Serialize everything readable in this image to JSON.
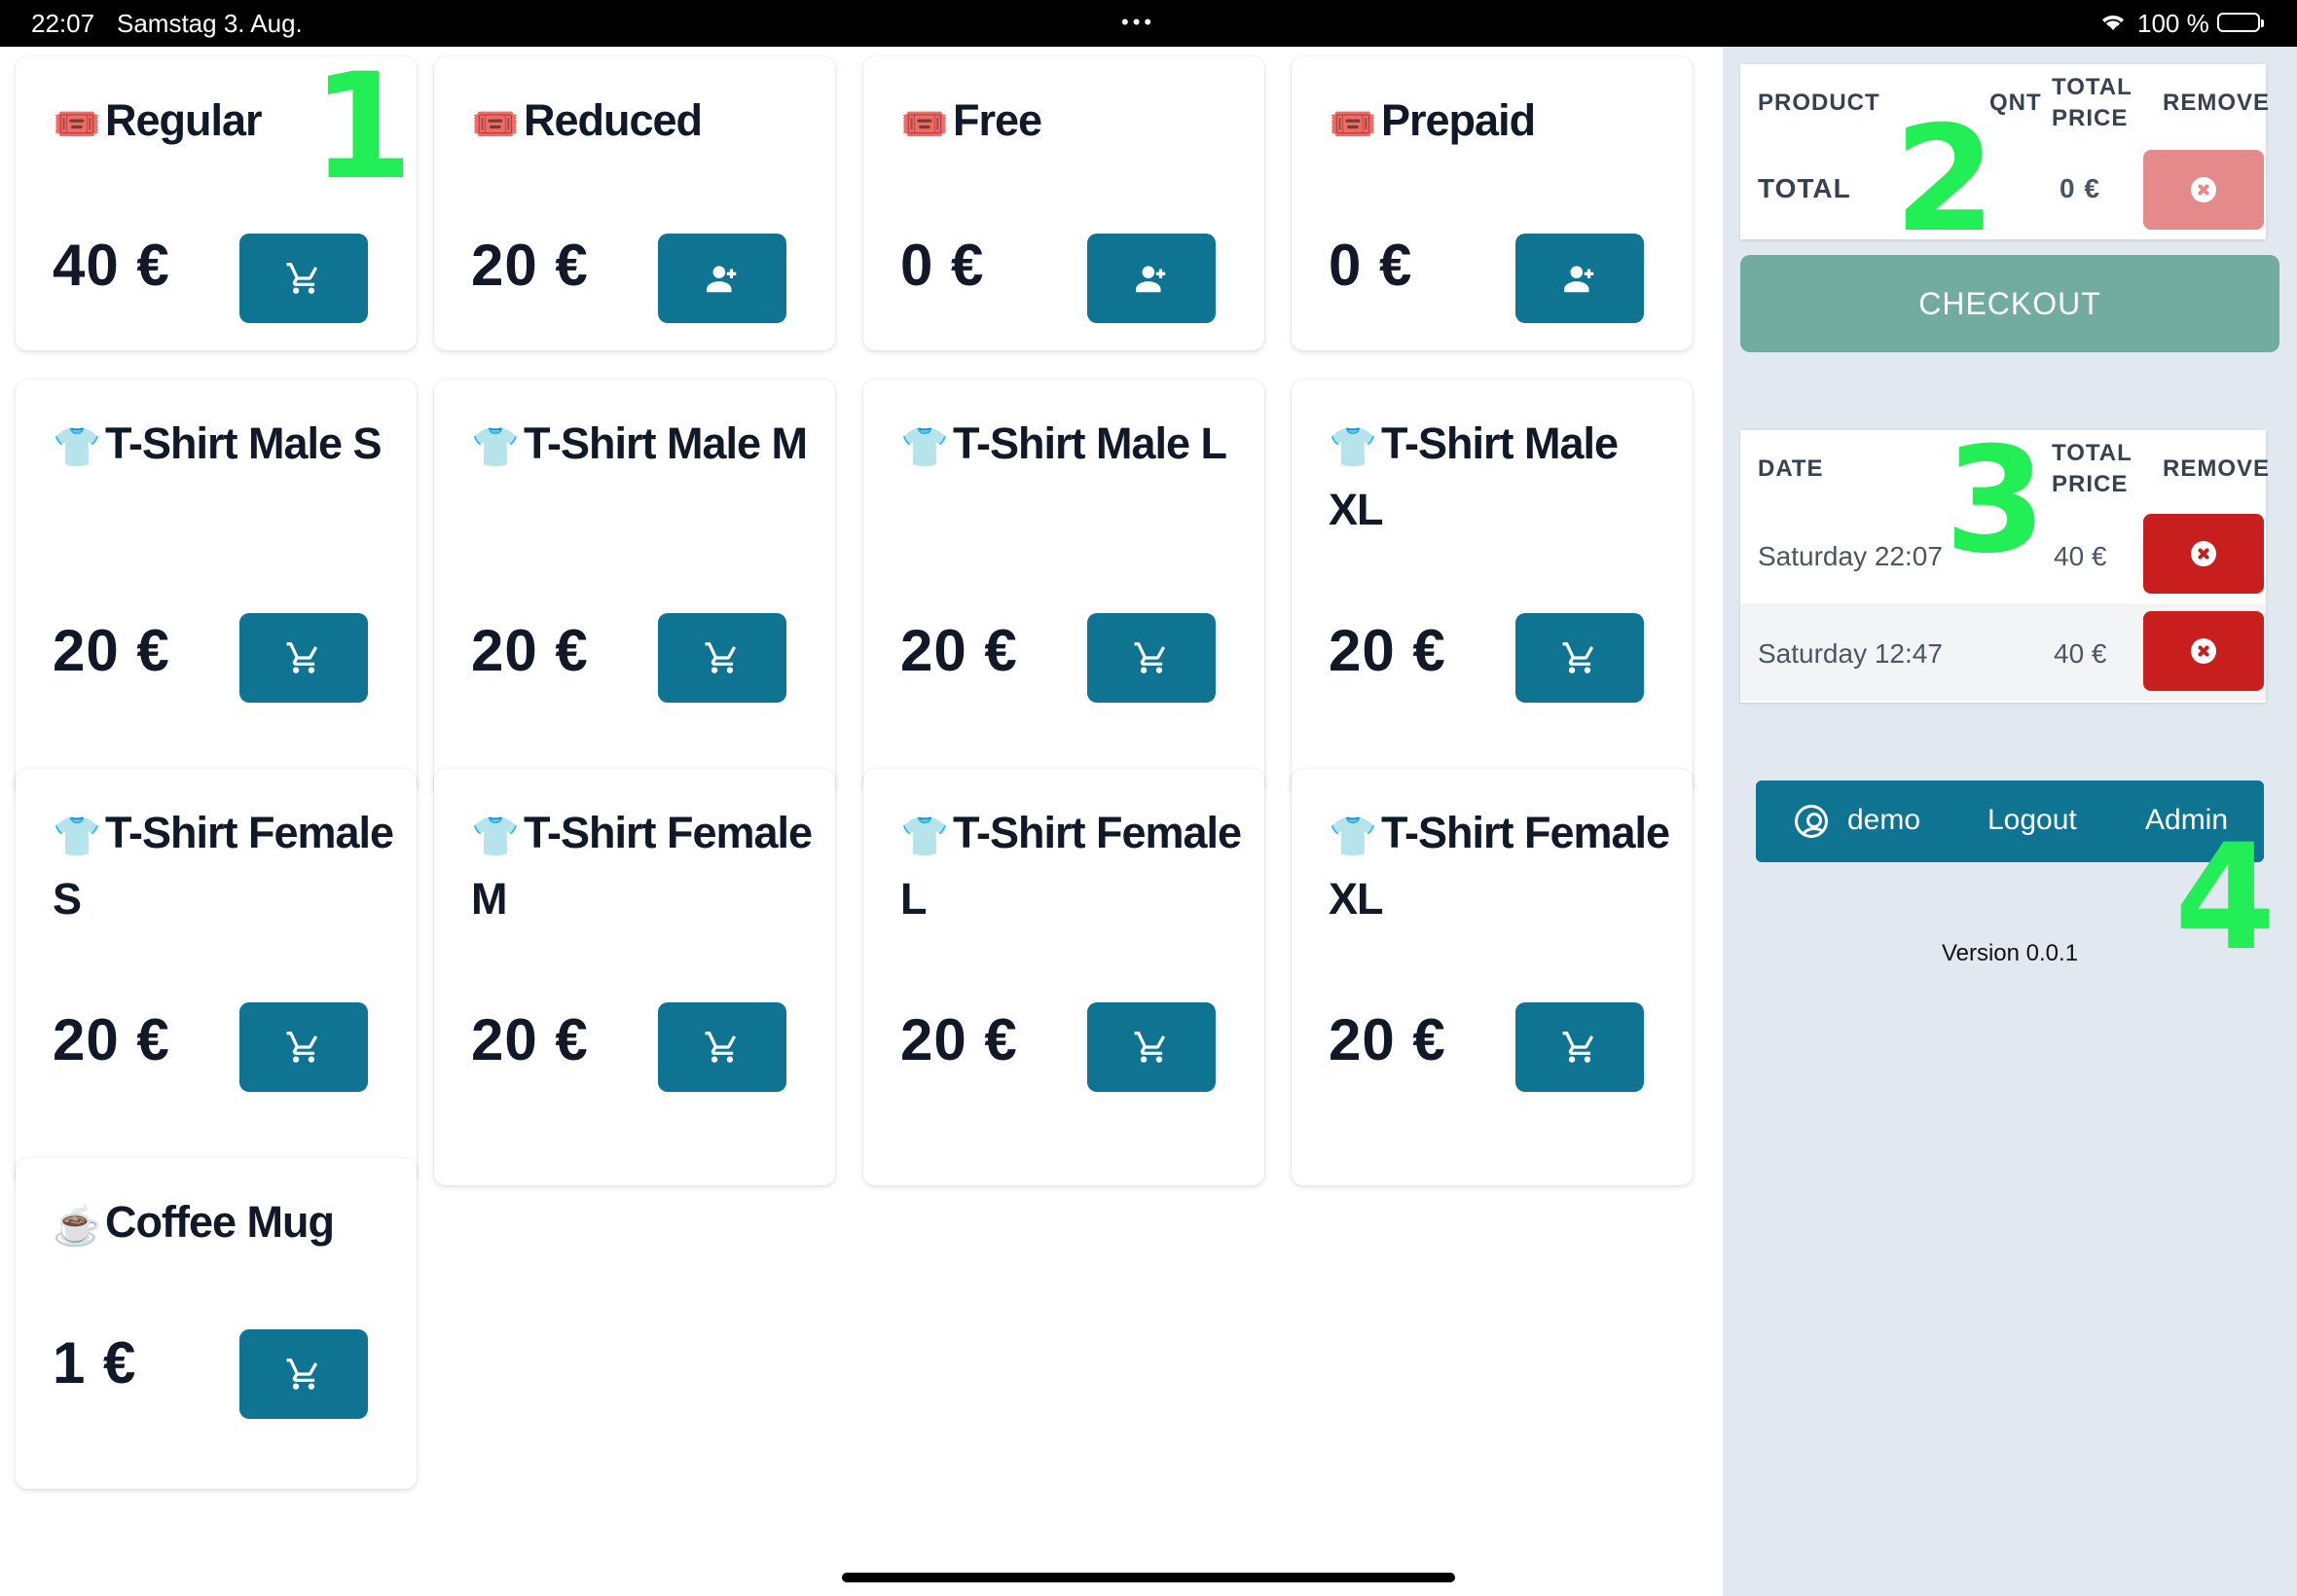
{
  "status_bar": {
    "time": "22:07",
    "date": "Samstag 3. Aug.",
    "dots": "•••",
    "battery": "100 %"
  },
  "products": [
    {
      "emoji": "🎟️",
      "name": "Regular",
      "price": "40 €",
      "action": "cart"
    },
    {
      "emoji": "🎟️",
      "name": "Reduced",
      "price": "20 €",
      "action": "add-person"
    },
    {
      "emoji": "🎟️",
      "name": "Free",
      "price": "0 €",
      "action": "add-person"
    },
    {
      "emoji": "🎟️",
      "name": "Prepaid",
      "price": "0 €",
      "action": "add-person"
    },
    {
      "emoji": "👕",
      "name": "T-Shirt Male S",
      "price": "20 €",
      "action": "cart"
    },
    {
      "emoji": "👕",
      "name": "T-Shirt Male M",
      "price": "20 €",
      "action": "cart"
    },
    {
      "emoji": "👕",
      "name": "T-Shirt Male L",
      "price": "20 €",
      "action": "cart"
    },
    {
      "emoji": "👕",
      "name": "T-Shirt Male XL",
      "price": "20 €",
      "action": "cart"
    },
    {
      "emoji": "👕",
      "name": "T-Shirt Female S",
      "price": "20 €",
      "action": "cart"
    },
    {
      "emoji": "👕",
      "name": "T-Shirt Female M",
      "price": "20 €",
      "action": "cart"
    },
    {
      "emoji": "👕",
      "name": "T-Shirt Female L",
      "price": "20 €",
      "action": "cart"
    },
    {
      "emoji": "👕",
      "name": "T-Shirt Female XL",
      "price": "20 €",
      "action": "cart"
    },
    {
      "emoji": "☕",
      "name": "Coffee Mug",
      "price": "1 €",
      "action": "cart"
    }
  ],
  "cart": {
    "headers": {
      "product": "PRODUCT",
      "qnt": "QNT",
      "total_price": "TOTAL PRICE",
      "remove": "REMOVE"
    },
    "total_label": "TOTAL",
    "total_value": "0 €"
  },
  "checkout_label": "CHECKOUT",
  "history": {
    "headers": {
      "date": "DATE",
      "total_price": "TOTAL PRICE",
      "remove": "REMOVE"
    },
    "rows": [
      {
        "date": "Saturday 22:07",
        "total": "40 €"
      },
      {
        "date": "Saturday 12:47",
        "total": "40 €"
      }
    ]
  },
  "user_bar": {
    "username": "demo",
    "logout": "Logout",
    "admin": "Admin"
  },
  "version": "Version 0.0.1",
  "markers": [
    "1",
    "2",
    "3",
    "4"
  ],
  "colors": {
    "primary": "#0f7492",
    "checkout": "#72aba0",
    "danger": "#c81e1e",
    "danger_faded": "#e48a8a",
    "sidebar_bg": "#e2e8f0",
    "marker": "#22ee55"
  }
}
